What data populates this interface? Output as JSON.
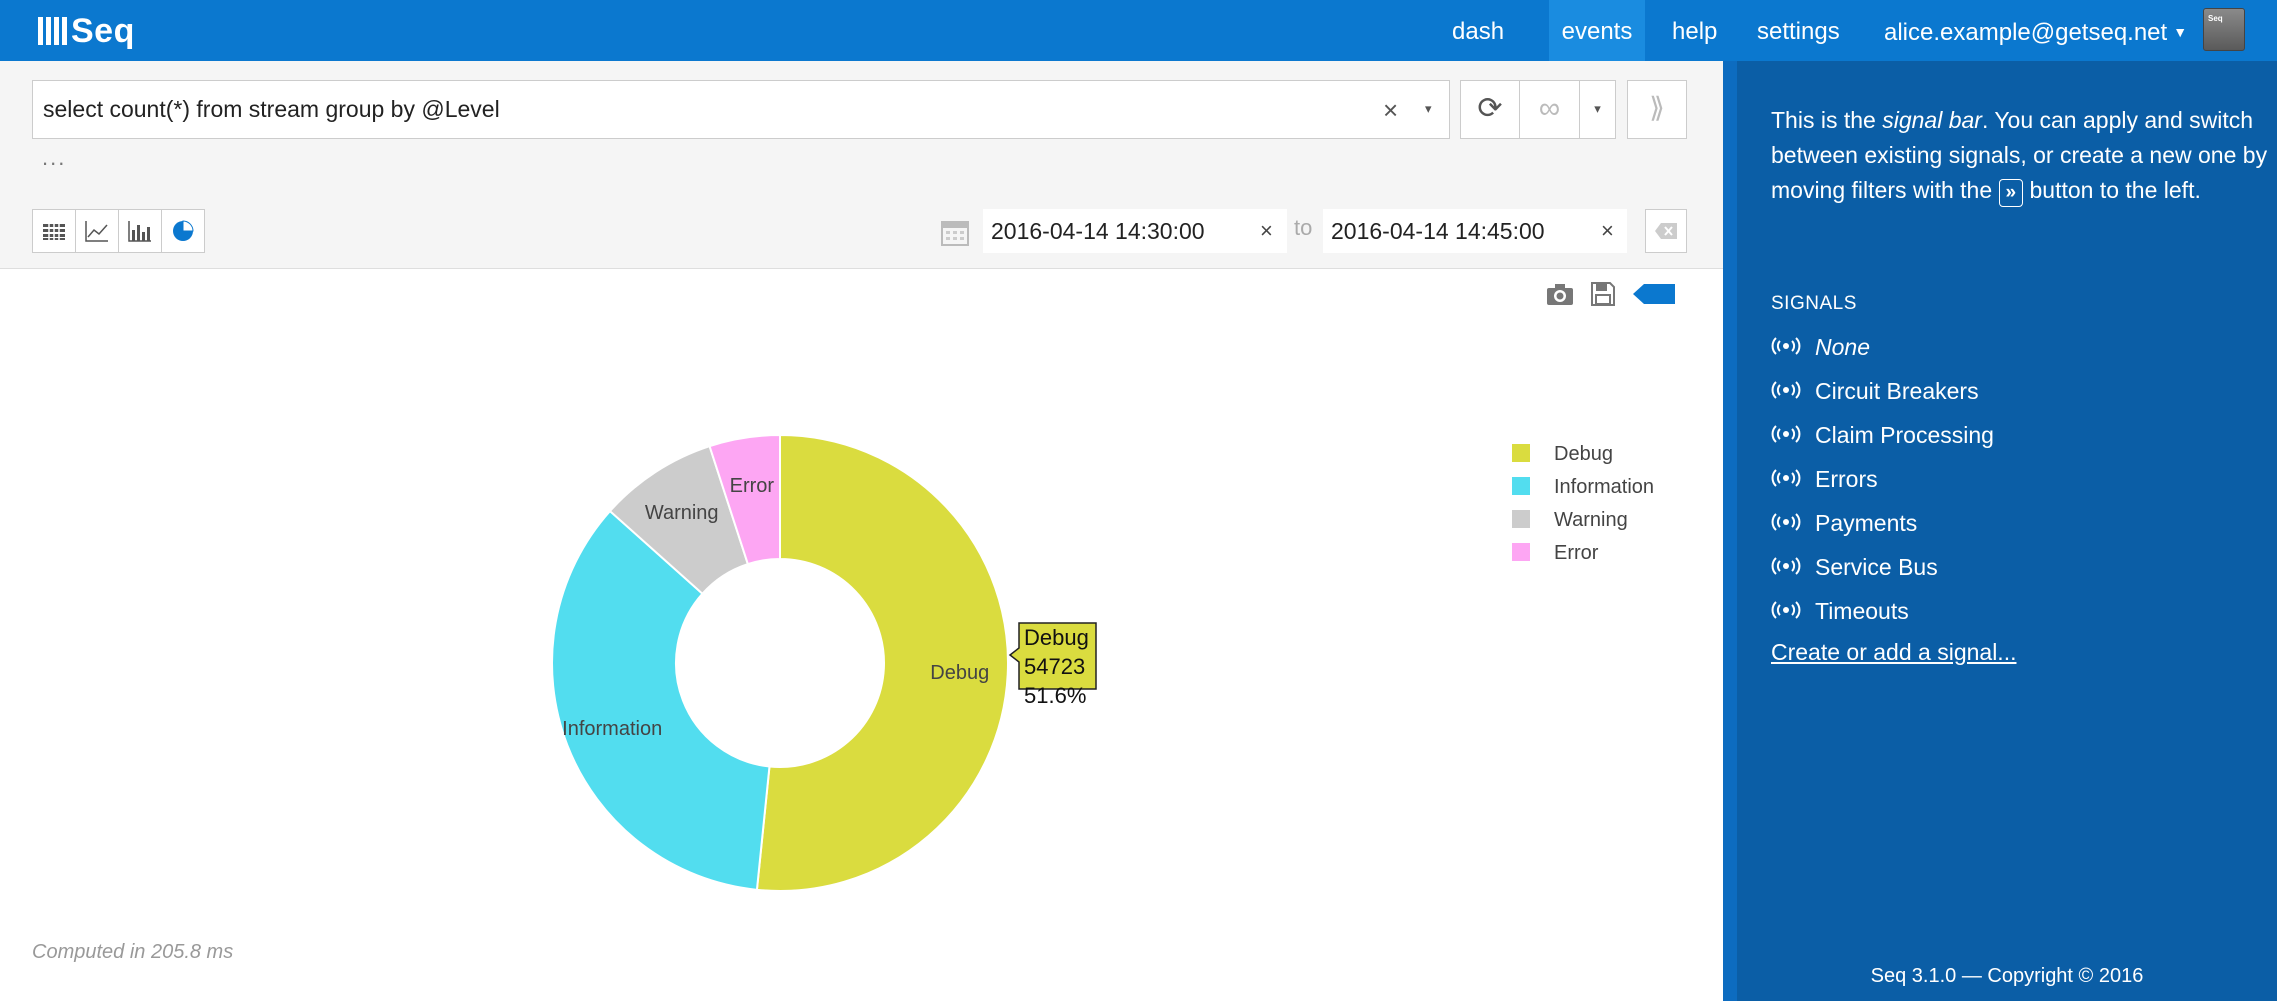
{
  "app": {
    "logo_text": "Seq"
  },
  "nav": {
    "dash": "dash",
    "events": "events",
    "help": "help",
    "settings": "settings",
    "user": "alice.example@getseq.net",
    "avatar_text": "Seq"
  },
  "query": {
    "value": "select count(*) from stream group by @Level",
    "clear": "×",
    "dropdown": "▾",
    "more": "..."
  },
  "toolbar": {
    "refresh": "⟳",
    "tail": "∞",
    "tail_menu": "▾",
    "move_filter": "⟫"
  },
  "range": {
    "from": "2016-04-14 14:30:00",
    "to_label": "to",
    "to": "2016-04-14 14:45:00",
    "clear": "×"
  },
  "chart_data": {
    "type": "pie",
    "donut": true,
    "categories": [
      "Debug",
      "Information",
      "Warning",
      "Error"
    ],
    "values": [
      54723,
      37100,
      8900,
      5300
    ],
    "colors": [
      "#dadc3f",
      "#52ddef",
      "#cccccc",
      "#fda6f3"
    ],
    "legend_position": "top-right",
    "tooltip": {
      "label": "Debug",
      "value": "54723",
      "percent": "51.6%"
    }
  },
  "computed": "Computed in 205.8 ms",
  "signals": {
    "intro_before": "This is the ",
    "intro_em": "signal bar",
    "intro_mid": ". You can apply and switch between existing signals, or create a new one by moving filters with the ",
    "intro_kbd": "»",
    "intro_after": " button to the left.",
    "heading": "SIGNALS",
    "items": [
      "None",
      "Circuit Breakers",
      "Claim Processing",
      "Errors",
      "Payments",
      "Service Bus",
      "Timeouts"
    ],
    "create": "Create or add a signal...",
    "footer": "Seq 3.1.0 — Copyright © 2016"
  },
  "colors": {
    "nav": "#0b78cf",
    "signalbar": "#0b5ea6",
    "accent": "#0b78cf"
  }
}
